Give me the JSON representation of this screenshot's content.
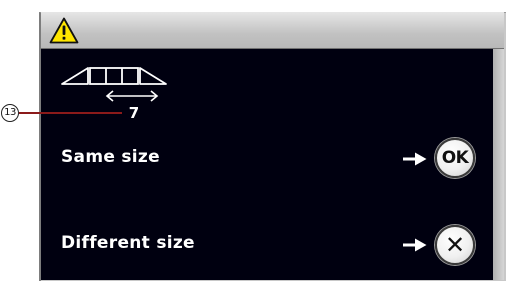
{
  "header": {
    "warning_icon": "warning-icon"
  },
  "diagram": {
    "icon": "stitch-width-icon",
    "value": "7"
  },
  "callout": {
    "number": "13",
    "line_color": "#8b1a1a"
  },
  "options": [
    {
      "label": "Same size",
      "arrow_icon": "arrow-right-icon",
      "button_label": "OK"
    },
    {
      "label": "Different size",
      "arrow_icon": "arrow-right-icon",
      "button_icon": "close-icon",
      "button_label": "✕"
    }
  ],
  "colors": {
    "screen_bg": "#000010",
    "text": "#ffffff",
    "warning_yellow": "#ffe600"
  }
}
